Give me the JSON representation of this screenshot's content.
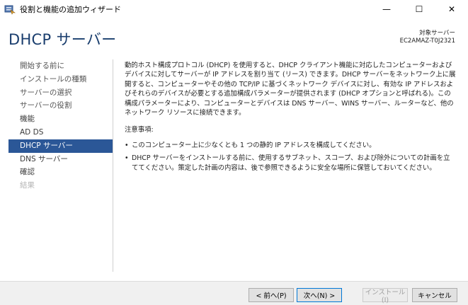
{
  "window": {
    "title": "役割と機能の追加ウィザード",
    "minimize": "—",
    "maximize": "☐",
    "close": "✕"
  },
  "header": {
    "page_title": "DHCP サーバー",
    "target_label": "対象サーバー",
    "target_server": "EC2AMAZ-T0J2321"
  },
  "sidebar": {
    "items": [
      {
        "label": "開始する前に",
        "state": "visited"
      },
      {
        "label": "インストールの種類",
        "state": "visited"
      },
      {
        "label": "サーバーの選択",
        "state": "visited"
      },
      {
        "label": "サーバーの役割",
        "state": "visited"
      },
      {
        "label": "機能",
        "state": "normal"
      },
      {
        "label": "AD DS",
        "state": "normal"
      },
      {
        "label": "DHCP サーバー",
        "state": "active"
      },
      {
        "label": "DNS サーバー",
        "state": "normal"
      },
      {
        "label": "確認",
        "state": "normal"
      },
      {
        "label": "結果",
        "state": "disabled"
      }
    ]
  },
  "content": {
    "intro": "動的ホスト構成プロトコル (DHCP) を使用すると、DHCP クライアント機能に対応したコンピューターおよびデバイスに対してサーバーが IP アドレスを割り当て (リース) できます。DHCP サーバーをネットワーク上に展開すると、コンピューターやその他の TCP/IP に基づくネットワーク デバイスに対し、有効な IP アドレスおよびそれらのデバイスが必要とする追加構成パラメーターが提供されます (DHCP オプションと呼ばれる)。この構成パラメーターにより、コンピューターとデバイスは DNS サーバー、WINS サーバー、ルーターなど、他のネットワーク リソースに接続できます。",
    "notes_title": "注意事項:",
    "bullet_glyph": "•",
    "notes": [
      "このコンピューター上に少なくとも 1 つの静的 IP アドレスを構成してください。",
      "DHCP サーバーをインストールする前に、使用するサブネット、スコープ、および除外についての計画を立ててください。策定した計画の内容は、後で参照できるように安全な場所に保管しておいてください。"
    ]
  },
  "footer": {
    "back_label": "< 前へ(P)",
    "next_label": "次へ(N) >",
    "install_label": "インストール(I)",
    "cancel_label": "キャンセル"
  },
  "colors": {
    "title_blue": "#1a3e6e",
    "active_nav_bg": "#2b5797"
  }
}
